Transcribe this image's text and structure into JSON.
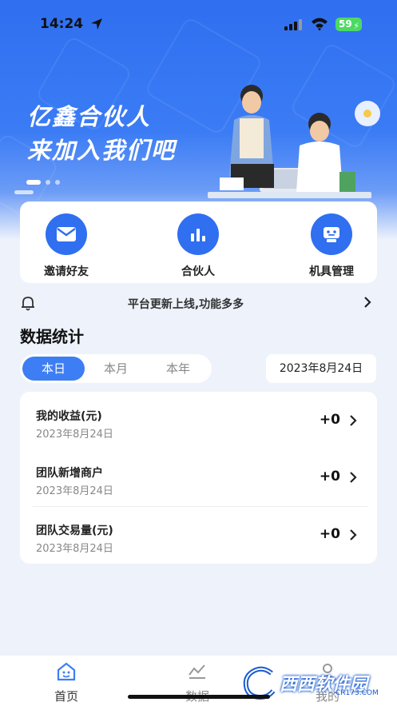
{
  "status_bar": {
    "time": "14:24",
    "battery": "59"
  },
  "banner": {
    "line1": "亿鑫合伙人",
    "line2": "来加入我们吧"
  },
  "quick_actions": [
    {
      "label": "邀请好友",
      "icon": "mail-icon"
    },
    {
      "label": "合伙人",
      "icon": "bar-chart-icon"
    },
    {
      "label": "机具管理",
      "icon": "device-icon"
    }
  ],
  "notice": {
    "text": "平台更新上线,功能多多"
  },
  "stats": {
    "title": "数据统计",
    "tabs": [
      "本日",
      "本月",
      "本年"
    ],
    "active_tab": "本日",
    "date": "2023年8月24日",
    "rows": [
      {
        "label": "我的收益(元)",
        "date": "2023年8月24日",
        "value": "+0"
      },
      {
        "label": "团队新增商户",
        "date": "2023年8月24日",
        "value": "+0"
      },
      {
        "label": "团队交易量(元)",
        "date": "2023年8月24日",
        "value": "+0"
      }
    ]
  },
  "tabbar": {
    "items": [
      {
        "label": "首页",
        "icon": "home-icon"
      },
      {
        "label": "数据",
        "icon": "data-chart-icon"
      },
      {
        "label": "我的",
        "icon": "profile-icon"
      }
    ]
  },
  "watermark": {
    "text": "西西软件园",
    "sub": "CR173.COM"
  },
  "colors": {
    "primary": "#3d7ef4",
    "accent": "#2f6ff0"
  }
}
